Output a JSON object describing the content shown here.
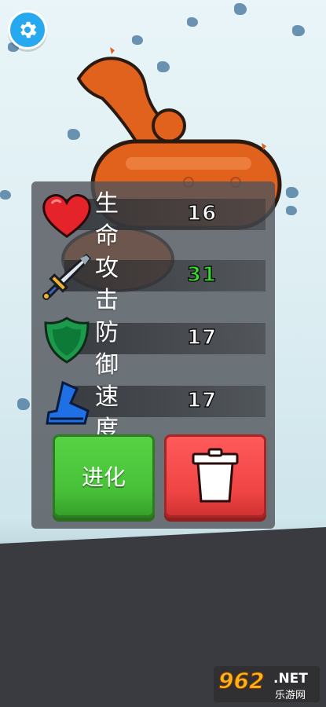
{
  "stats": [
    {
      "label": "生命",
      "value": "16",
      "icon": "heart-icon",
      "value_color": "#ffffff"
    },
    {
      "label": "攻击",
      "value": "31",
      "icon": "sword-icon",
      "value_color": "#33dd2a"
    },
    {
      "label": "防御",
      "value": "17",
      "icon": "shield-icon",
      "value_color": "#ffffff"
    },
    {
      "label": "速度",
      "value": "17",
      "icon": "boot-icon",
      "value_color": "#ffffff"
    }
  ],
  "labels_vertical": [
    "生",
    "命",
    "攻",
    "击",
    "防",
    "御",
    "速",
    "度"
  ],
  "buttons": {
    "evolve_label": "进化",
    "delete_icon": "trash-icon"
  },
  "watermark": {
    "number": "962",
    "net": ".NET",
    "subtitle": "乐游网"
  },
  "colors": {
    "accent_green": "#47c038",
    "accent_red": "#f04444",
    "settings_blue": "#27a9ef",
    "creature_orange": "#e0621c"
  }
}
